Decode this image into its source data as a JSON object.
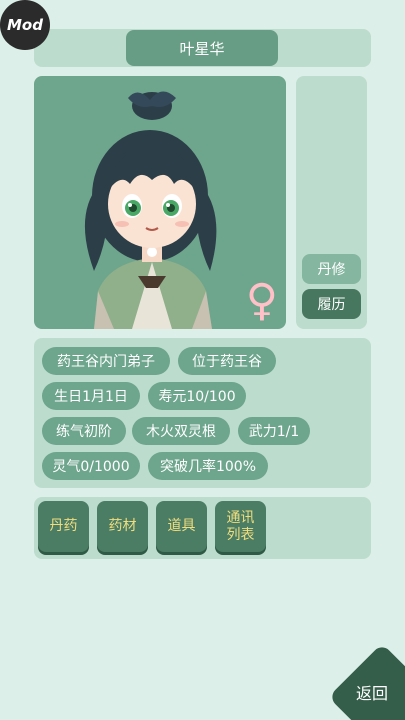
{
  "mod_badge": "Mod",
  "character": {
    "name": "叶星华",
    "gender_symbol": "♀"
  },
  "side_buttons": {
    "alchemy": "丹修",
    "resume": "履历"
  },
  "info_tags": [
    "药王谷内门弟子",
    "位于药王谷",
    "生日1月1日",
    "寿元10/100",
    "练气初阶",
    "木火双灵根",
    "武力1/1",
    "灵气0/1000",
    "突破几率100%"
  ],
  "actions": {
    "pills": "丹药",
    "herbs": "药材",
    "items": "道具",
    "contacts_line1": "通讯",
    "contacts_line2": "列表"
  },
  "back_label": "返回",
  "colors": {
    "background": "#dcefe8",
    "panel": "#bcdccd",
    "tag": "#6ea58d",
    "button_dark": "#4a7d64",
    "button_text": "#f2dd7e",
    "female_symbol": "#ffc0c8"
  }
}
